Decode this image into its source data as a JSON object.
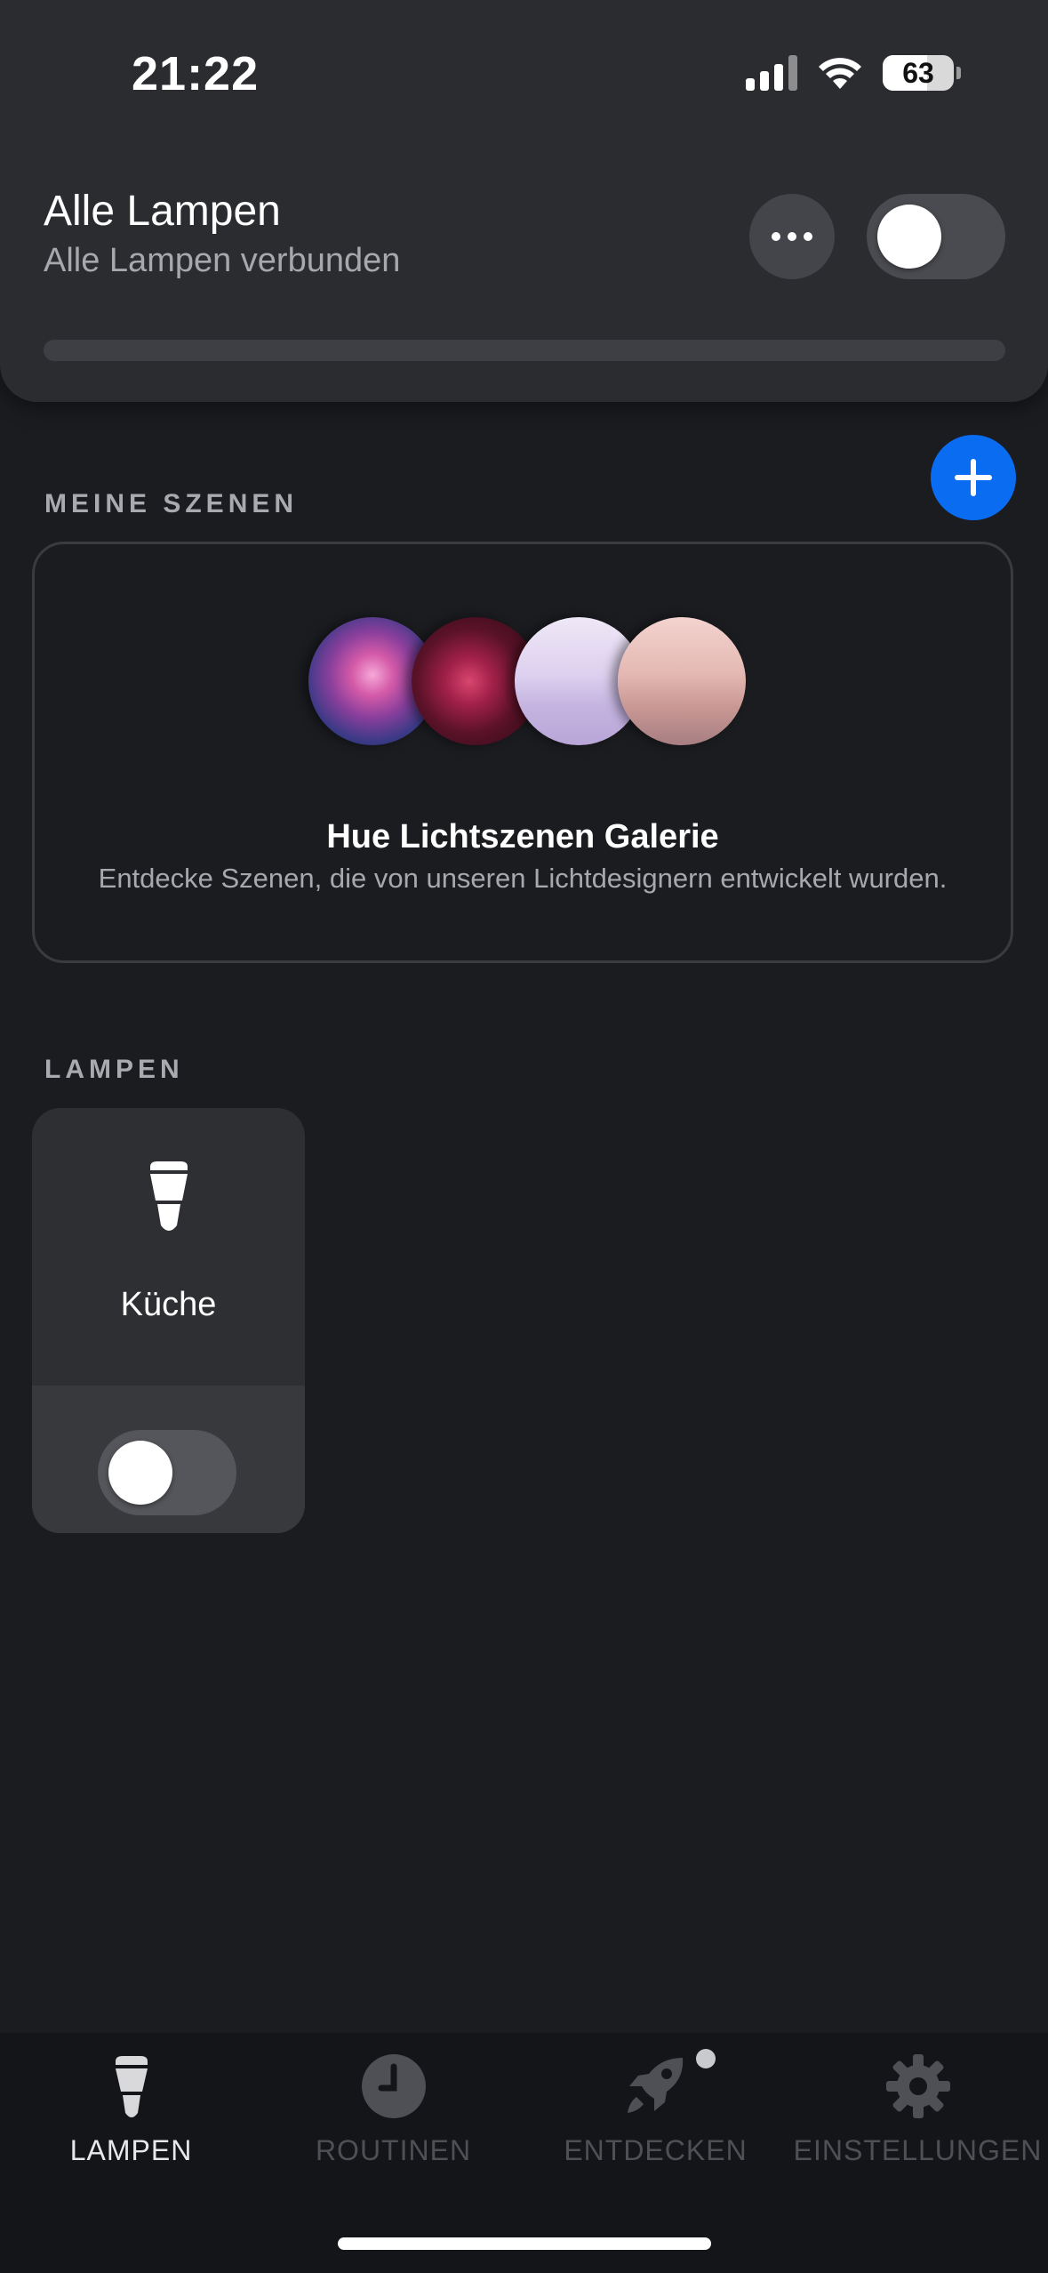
{
  "status_bar": {
    "time": "21:22",
    "battery": "63"
  },
  "header": {
    "title": "Alle Lampen",
    "subtitle": "Alle Lampen verbunden",
    "toggle_on": false
  },
  "scenes": {
    "section_label": "MEINE SZENEN",
    "gallery_title": "Hue Lichtszenen Galerie",
    "gallery_subtitle": "Entdecke Szenen, die von unseren Lichtdesignern entwickelt wurden."
  },
  "lamps": {
    "section_label": "LAMPEN",
    "items": [
      {
        "name": "Küche",
        "on": false
      }
    ]
  },
  "bottom_nav": {
    "items": [
      {
        "label": "LAMPEN",
        "icon": "lamp-icon",
        "active": true
      },
      {
        "label": "ROUTINEN",
        "icon": "clock-icon",
        "active": false
      },
      {
        "label": "ENTDECKEN",
        "icon": "rocket-icon",
        "active": false,
        "badge": true
      },
      {
        "label": "EINSTELLUNGEN",
        "icon": "gear-icon",
        "active": false
      }
    ]
  },
  "colors": {
    "accent": "#0a6cf0",
    "background": "#1b1c20",
    "card": "#2b2c30"
  }
}
